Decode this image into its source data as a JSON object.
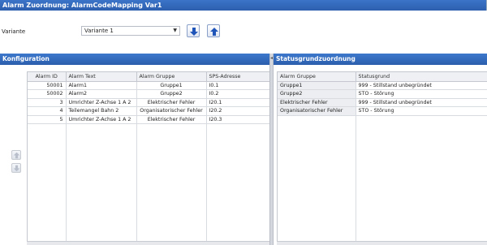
{
  "window": {
    "title": "Alarm Zuordnung: AlarmCodeMapping Var1"
  },
  "variant": {
    "label": "Variante",
    "selected": "Variante 1",
    "down_icon": "arrow-down-icon",
    "up_icon": "arrow-up-icon"
  },
  "left_panel": {
    "title": "Konfiguration",
    "columns": [
      "Alarm ID",
      "Alarm Text",
      "Alarm Gruppe",
      "SPS-Adresse"
    ],
    "rows": [
      [
        "50001",
        "Alarm1",
        "Gruppe1",
        "I0.1"
      ],
      [
        "50002",
        "Alarm2",
        "Gruppe2",
        "I0.2"
      ],
      [
        "3",
        "Umrichter Z-Achse 1 A 2",
        "Elektrischer Fehler",
        "I20.1"
      ],
      [
        "4",
        "Teilemangel Bahn 2",
        "Organisatorischer Fehler",
        "I20.2"
      ],
      [
        "5",
        "Umrichter Z-Achse 1 A 2",
        "Elektrischer Fehler",
        "I20.3"
      ]
    ]
  },
  "right_panel": {
    "title": "Statusgrundzuordnung",
    "columns": [
      "Alarm Gruppe",
      "Statusgrund"
    ],
    "rows": [
      [
        "Gruppe1",
        "999 - Stillstand unbegründet"
      ],
      [
        "Gruppe2",
        "STO - Störung"
      ],
      [
        "Elektrischer Fehler",
        "999 - Stillstand unbegründet"
      ],
      [
        "Organisatorischer Fehler",
        "STO - Störung"
      ]
    ]
  },
  "colors": {
    "header_blue": "#2f63b3",
    "grid_line": "#d8dbe0"
  }
}
